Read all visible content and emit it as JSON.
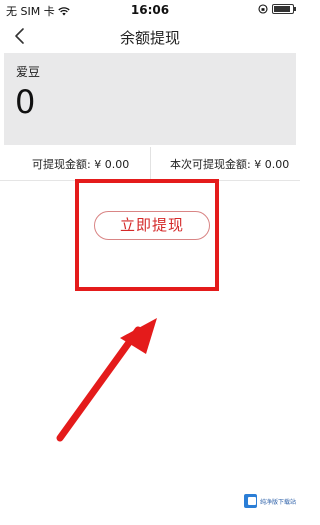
{
  "status_bar": {
    "carrier": "无 SIM 卡",
    "time": "16:06",
    "battery_level": 0.9
  },
  "nav": {
    "title": "余额提现",
    "back_icon": "chevron-left-icon"
  },
  "balance_card": {
    "label": "爱豆",
    "value": "0"
  },
  "amounts": {
    "available": "可提现金额: ¥ 0.00",
    "this_time": "本次可提现金额: ¥ 0.00"
  },
  "withdraw_button": {
    "label": "立即提现"
  },
  "annotation": {
    "color": "#e41b1b"
  },
  "watermark": {
    "text": "纯净版下载站"
  }
}
